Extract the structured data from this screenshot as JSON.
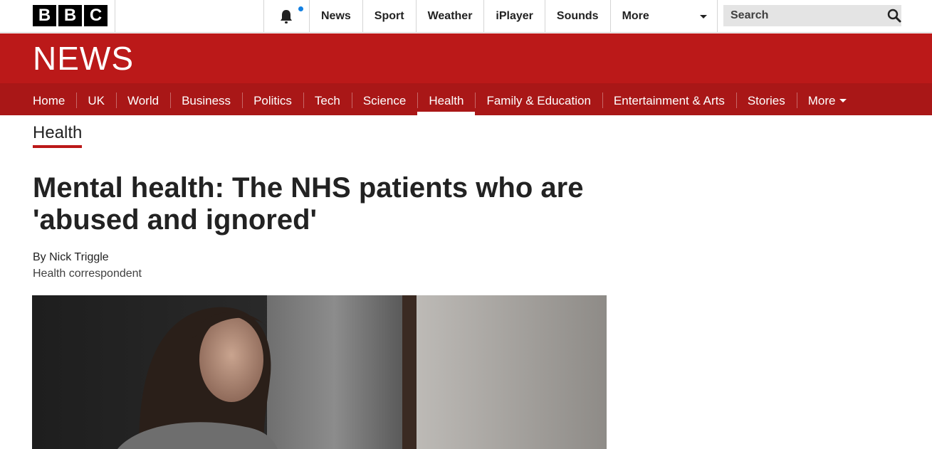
{
  "brand": {
    "letters": [
      "B",
      "B",
      "C"
    ]
  },
  "topnav": {
    "items": [
      "News",
      "Sport",
      "Weather",
      "iPlayer",
      "Sounds"
    ],
    "more_label": "More"
  },
  "search": {
    "placeholder": "Search"
  },
  "news_banner": {
    "title": "NEWS"
  },
  "section_nav": {
    "items": [
      "Home",
      "UK",
      "World",
      "Business",
      "Politics",
      "Tech",
      "Science",
      "Health",
      "Family & Education",
      "Entertainment & Arts",
      "Stories"
    ],
    "active": "Health",
    "more_label": "More"
  },
  "article": {
    "section": "Health",
    "headline": "Mental health: The NHS patients who are 'abused and ignored'",
    "byline_name": "By Nick Triggle",
    "byline_role": "Health correspondent"
  },
  "colors": {
    "brand_red": "#bb1919",
    "nav_red": "#a91717",
    "notification_dot": "#1380e2"
  }
}
